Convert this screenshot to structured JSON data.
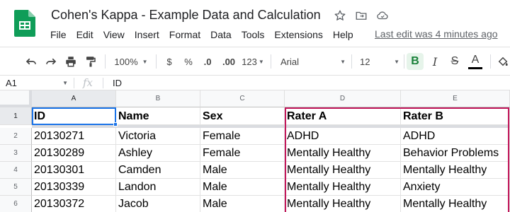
{
  "doc": {
    "title": "Cohen's Kappa - Example Data and Calculation",
    "last_edit": "Last edit was 4 minutes ago"
  },
  "menu": [
    "File",
    "Edit",
    "View",
    "Insert",
    "Format",
    "Data",
    "Tools",
    "Extensions",
    "Help"
  ],
  "toolbar": {
    "zoom": "100%",
    "currency": "$",
    "percent": "%",
    "decrease_decimal": ".0",
    "increase_decimal": ".00",
    "more_formats": "123",
    "font": "Arial",
    "font_size": "12",
    "bold": "B",
    "italic": "I",
    "strikethrough": "S",
    "text_color": "A"
  },
  "formula_bar": {
    "cell_ref": "A1",
    "fx": "fx",
    "content": "ID"
  },
  "columns": [
    "A",
    "B",
    "C",
    "D",
    "E"
  ],
  "rows": [
    "1",
    "2",
    "3",
    "4",
    "5",
    "6"
  ],
  "cells": [
    [
      "ID",
      "Name",
      "Sex",
      "Rater A",
      "Rater B"
    ],
    [
      "20130271",
      "Victoria",
      "Female",
      "ADHD",
      "ADHD"
    ],
    [
      "20130289",
      "Ashley",
      "Female",
      "Mentally Healthy",
      "Behavior Problems"
    ],
    [
      "20130301",
      "Camden",
      "Male",
      "Mentally Healthy",
      "Mentally Healthy"
    ],
    [
      "20130339",
      "Landon",
      "Male",
      "Mentally Healthy",
      "Anxiety"
    ],
    [
      "20130372",
      "Jacob",
      "Male",
      "Mentally Healthy",
      "Mentally Healthy"
    ]
  ],
  "colors": {
    "accent": "#1a73e8",
    "highlight_border": "#c2185b",
    "logo_green": "#0f9d58"
  },
  "icons": [
    "sheets-logo",
    "star-icon",
    "move-to-folder-icon",
    "cloud-status-icon",
    "undo-icon",
    "redo-icon",
    "print-icon",
    "paint-format-icon",
    "fill-color-icon"
  ]
}
